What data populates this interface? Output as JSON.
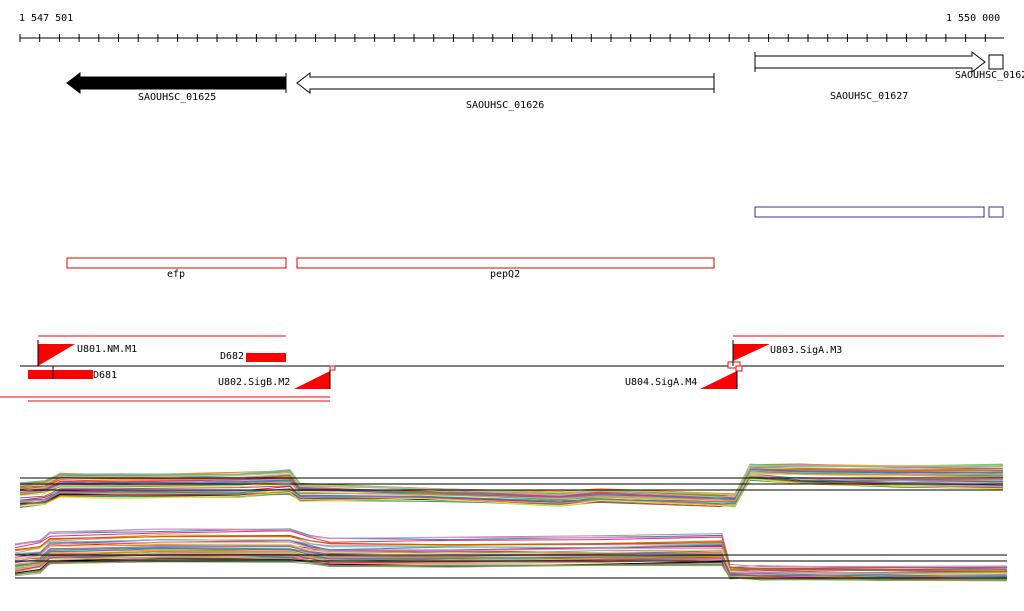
{
  "ruler": {
    "start_label": "1 547 501",
    "end_label": "1 550 000"
  },
  "genes": [
    {
      "name": "SAOUHSC_01625",
      "strand": "-",
      "filled": true
    },
    {
      "name": "SAOUHSC_01626",
      "strand": "-",
      "filled": false
    },
    {
      "name": "SAOUHSC_01627",
      "strand": "+",
      "filled": false
    },
    {
      "name": "SAOUHSC_0162",
      "strand": "+",
      "filled": false
    }
  ],
  "annotations": [
    {
      "name": "efp"
    },
    {
      "name": "pepQ2"
    }
  ],
  "features": [
    {
      "name": "U801.NM.M1"
    },
    {
      "name": "D682"
    },
    {
      "name": "D681"
    },
    {
      "name": "U802.SigB.M2"
    },
    {
      "name": "U804.SigA.M4"
    },
    {
      "name": "U803.SigA.M3"
    }
  ],
  "colors": {
    "gene_fill": "#000000",
    "annotation_box": "#dd0000",
    "feature_red": "#ff0000",
    "transcript_blue": "#333399"
  }
}
